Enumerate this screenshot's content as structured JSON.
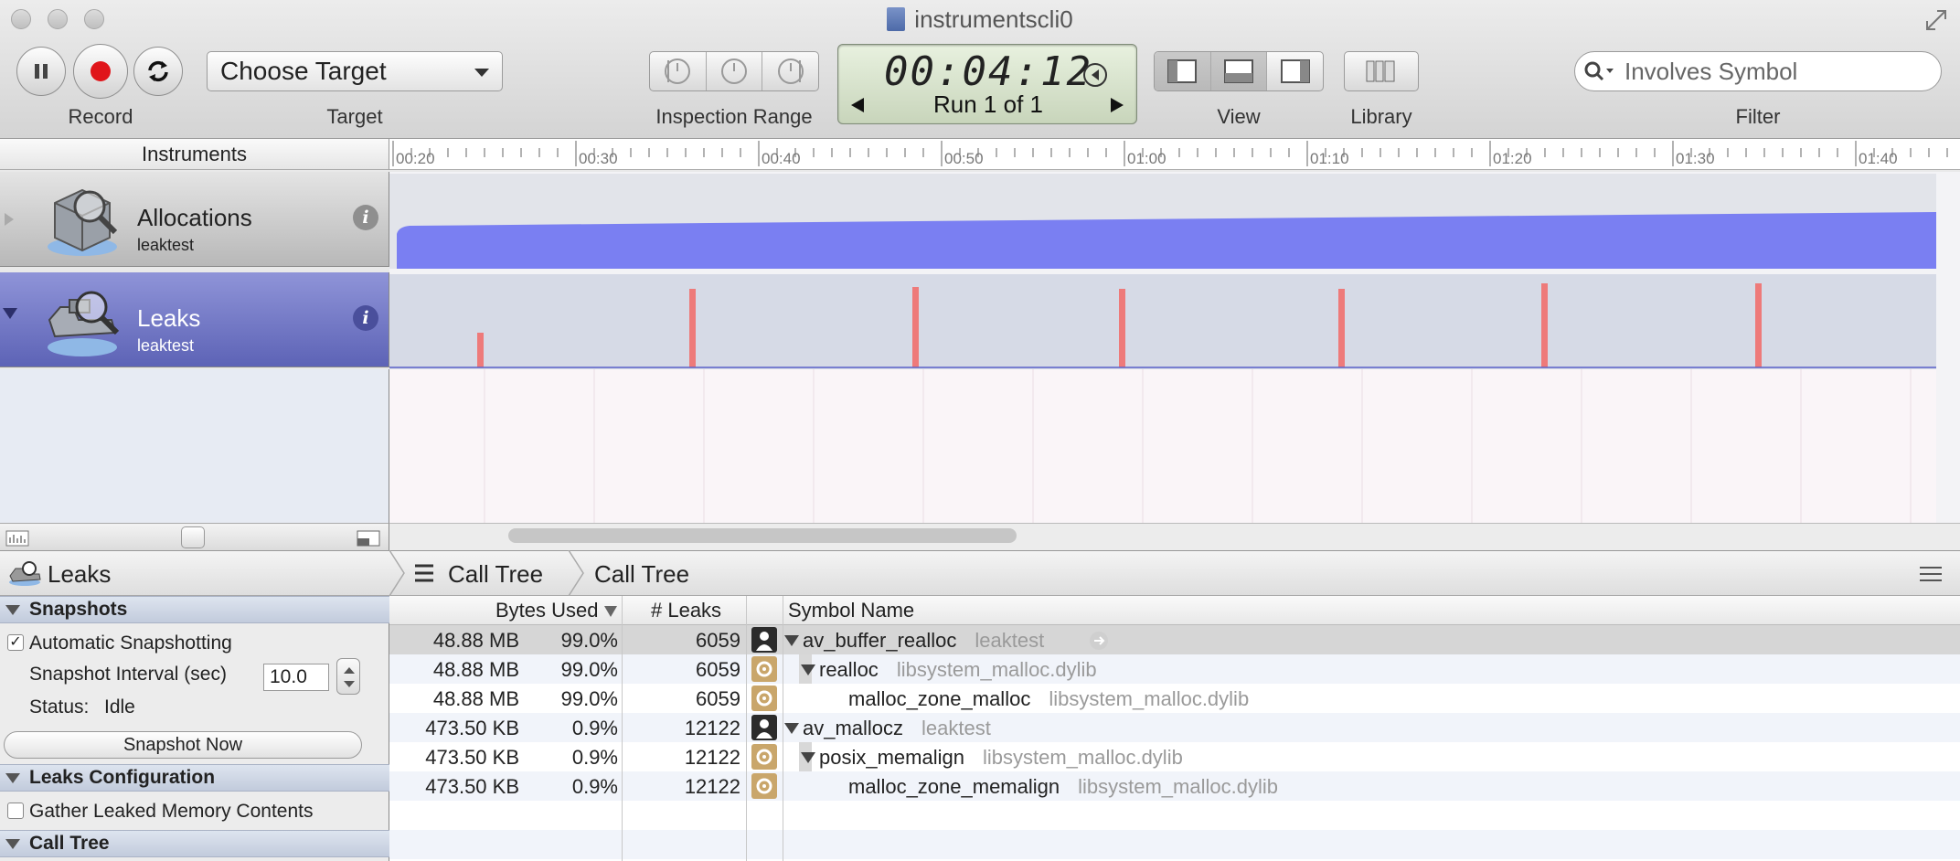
{
  "window": {
    "title": "instrumentscli0"
  },
  "toolbar": {
    "record_label": "Record",
    "target_label": "Target",
    "target_value": "Choose Target",
    "inspection_label": "Inspection Range",
    "view_label": "View",
    "library_label": "Library",
    "filter_label": "Filter",
    "filter_placeholder": "Involves Symbol",
    "timer": "00:04:12",
    "run_text": "Run 1 of 1"
  },
  "instruments": {
    "header": "Instruments",
    "ruler_ticks": [
      "00:20",
      "00:30",
      "00:40",
      "00:50",
      "01:00",
      "01:10",
      "01:20",
      "01:30",
      "01:40"
    ],
    "tracks": [
      {
        "name": "Allocations",
        "process": "leaktest"
      },
      {
        "name": "Leaks",
        "process": "leaktest"
      }
    ]
  },
  "detail": {
    "instrument": "Leaks",
    "crumbs": [
      "Call Tree",
      "Call Tree"
    ]
  },
  "sidebar": {
    "snapshots_title": "Snapshots",
    "auto_snapshot_label": "Automatic Snapshotting",
    "auto_snapshot_checked": true,
    "interval_label": "Snapshot Interval (sec)",
    "interval_value": "10.0",
    "status_label": "Status:",
    "status_value": "Idle",
    "snapshot_button": "Snapshot Now",
    "leaks_config_title": "Leaks Configuration",
    "gather_label": "Gather Leaked Memory Contents",
    "gather_checked": false,
    "call_tree_title": "Call Tree"
  },
  "table": {
    "columns": {
      "bytes": "Bytes Used",
      "leaks": "# Leaks",
      "symbol": "Symbol Name"
    },
    "rows": [
      {
        "bytes": "48.88 MB",
        "pct": "99.0%",
        "leaks": "6059",
        "icon": "person-icon",
        "symbol": "av_buffer_realloc",
        "library": "leaktest",
        "indent": 0,
        "disclosure": true,
        "selected": true
      },
      {
        "bytes": "48.88 MB",
        "pct": "99.0%",
        "leaks": "6059",
        "icon": "gear-icon",
        "symbol": "realloc",
        "library": "libsystem_malloc.dylib",
        "indent": 1,
        "disclosure": true,
        "selected": false
      },
      {
        "bytes": "48.88 MB",
        "pct": "99.0%",
        "leaks": "6059",
        "icon": "gear-icon",
        "symbol": "malloc_zone_malloc",
        "library": "libsystem_malloc.dylib",
        "indent": 2,
        "disclosure": false,
        "selected": false
      },
      {
        "bytes": "473.50 KB",
        "pct": "0.9%",
        "leaks": "12122",
        "icon": "person-icon",
        "symbol": "av_mallocz",
        "library": "leaktest",
        "indent": 0,
        "disclosure": true,
        "selected": false
      },
      {
        "bytes": "473.50 KB",
        "pct": "0.9%",
        "leaks": "12122",
        "icon": "gear-icon",
        "symbol": "posix_memalign",
        "library": "libsystem_malloc.dylib",
        "indent": 1,
        "disclosure": true,
        "selected": false
      },
      {
        "bytes": "473.50 KB",
        "pct": "0.9%",
        "leaks": "12122",
        "icon": "gear-icon",
        "symbol": "malloc_zone_memalign",
        "library": "libsystem_malloc.dylib",
        "indent": 2,
        "disclosure": false,
        "selected": false
      }
    ]
  },
  "colors": {
    "allocations_fill": "#7a7ff2",
    "leak_spike": "#ee7a7a",
    "selected_track": "#6a70c4"
  }
}
